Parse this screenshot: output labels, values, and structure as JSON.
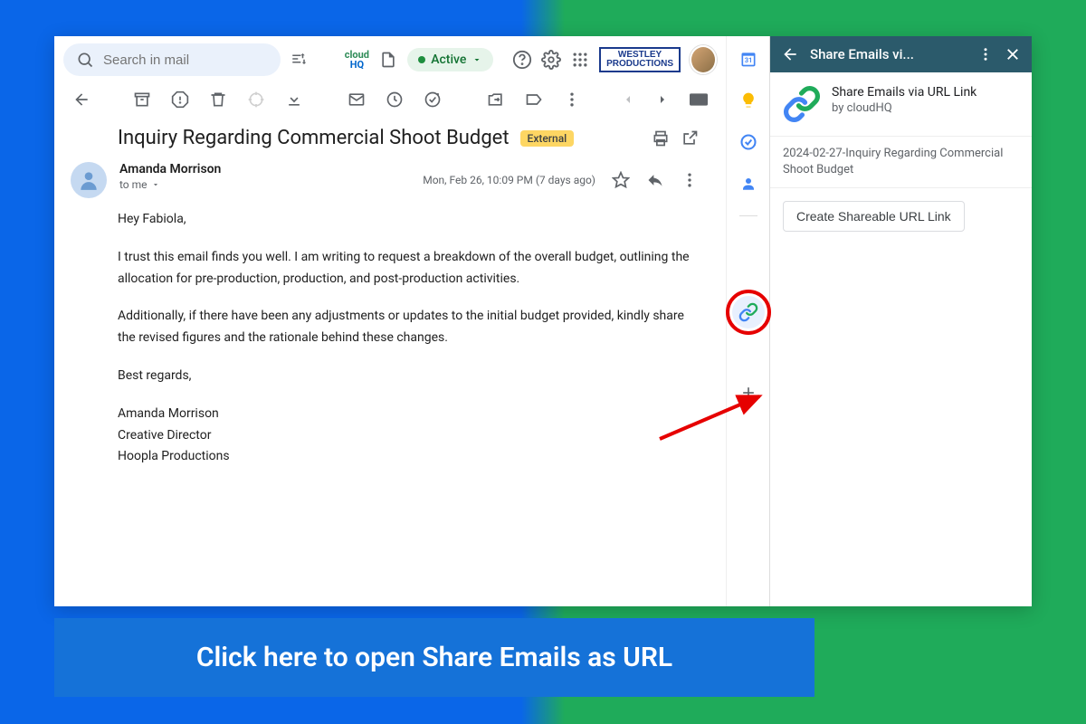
{
  "search": {
    "placeholder": "Search in mail"
  },
  "active_chip": "Active",
  "logo": {
    "line1": "WESTLEY",
    "line2": "PRODUCTIONS"
  },
  "cloudhq": {
    "line1": "cloud",
    "line2": "HQ"
  },
  "email": {
    "subject": "Inquiry Regarding Commercial Shoot Budget",
    "external": "External",
    "sender": "Amanda Morrison",
    "to": "to me",
    "date": "Mon, Feb 26, 10:09 PM (7 days ago)",
    "body": {
      "greeting": "Hey Fabiola,",
      "p1": "I trust this email finds you well. I am writing to request a breakdown of the overall budget, outlining the allocation for pre-production, production, and post-production activities.",
      "p2": "Additionally, if there have been any adjustments or updates to the initial budget provided, kindly share the revised figures and the rationale behind these changes.",
      "closing": "Best regards,",
      "sig1": "Amanda Morrison",
      "sig2": "Creative Director",
      "sig3": "Hoopla Productions"
    }
  },
  "panel": {
    "header": "Share Emails vi...",
    "title": "Share Emails via URL Link",
    "by": "by cloudHQ",
    "subject_line": "2024-02-27-Inquiry Regarding Commercial Shoot Budget",
    "button": "Create Shareable URL Link"
  },
  "caption": "Click here to open Share Emails as URL"
}
